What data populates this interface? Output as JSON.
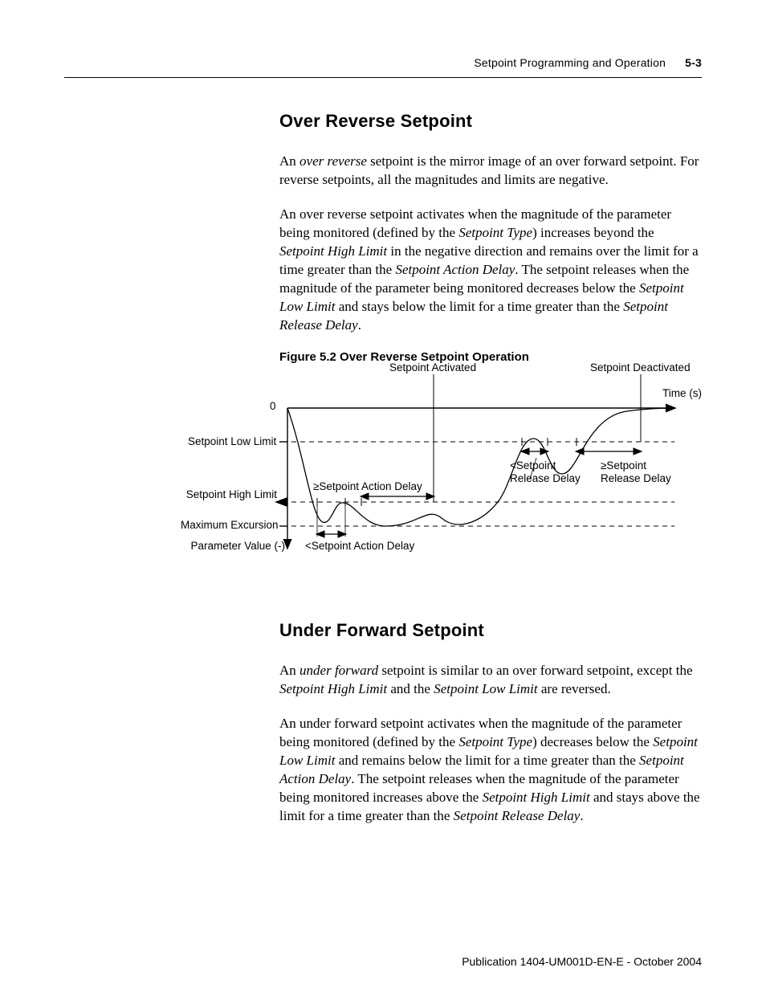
{
  "header": {
    "section": "Setpoint Programming and Operation",
    "page_number": "5-3"
  },
  "section1": {
    "heading": "Over Reverse Setpoint",
    "p1_a": "An ",
    "p1_b": "over reverse",
    "p1_c": " setpoint is the mirror image of an over forward setpoint. For reverse setpoints, all the magnitudes and limits are negative.",
    "p2_a": "An over reverse setpoint activates when the magnitude of the parameter being monitored (defined by the ",
    "p2_b": "Setpoint Type",
    "p2_c": ") increases beyond the ",
    "p2_d": "Setpoint High Limit",
    "p2_e": " in the negative direction and remains over the limit for a time greater than the ",
    "p2_f": "Setpoint Action Delay",
    "p2_g": ". The setpoint releases when the magnitude of the parameter being monitored decreases below the ",
    "p2_h": "Setpoint Low Limit",
    "p2_i": " and stays below the limit for a time greater than the ",
    "p2_j": "Setpoint Release Delay",
    "p2_k": "."
  },
  "figure": {
    "caption": "Figure 5.2 Over Reverse Setpoint Operation",
    "labels": {
      "setpoint_activated": "Setpoint Activated",
      "setpoint_deactivated": "Setpoint Deactivated",
      "time": "Time (s)",
      "zero": "0",
      "low_limit": "Setpoint Low Limit",
      "high_limit": "Setpoint High Limit",
      "max_excursion": "Maximum Excursion",
      "param_value": "Parameter Value (-)",
      "ge_action_delay": "≥Setpoint Action Delay",
      "lt_action_delay": "<Setpoint Action Delay",
      "lt_release_label": "<Setpoint\nRelease Delay",
      "ge_release_label": "≥Setpoint\nRelease Delay"
    }
  },
  "section2": {
    "heading": "Under Forward Setpoint",
    "p1_a": "An ",
    "p1_b": "under forward",
    "p1_c": " setpoint is similar to an over forward setpoint, except the ",
    "p1_d": "Setpoint High Limit",
    "p1_e": " and the ",
    "p1_f": "Setpoint Low Limit",
    "p1_g": " are reversed.",
    "p2_a": "An under forward setpoint activates when the magnitude of the parameter being monitored (defined by the ",
    "p2_b": "Setpoint Type",
    "p2_c": ") decreases below the ",
    "p2_d": "Setpoint Low Limit",
    "p2_e": " and remains below the limit for a time greater than the ",
    "p2_f": "Setpoint Action Delay",
    "p2_g": ". The setpoint releases when the magnitude of the parameter being monitored increases above the ",
    "p2_h": "Setpoint High Limit",
    "p2_i": " and stays above the limit for a time greater than the ",
    "p2_j": "Setpoint Release Delay",
    "p2_k": "."
  },
  "footer": {
    "text": "Publication 1404-UM001D-EN-E - October 2004"
  },
  "chart_data": {
    "type": "line",
    "title": "Figure 5.2 Over Reverse Setpoint Operation",
    "xlabel": "Time (s)",
    "ylabel": "Parameter Value (-)",
    "y_zero": 0,
    "y_low_limit": "Setpoint Low Limit (negative)",
    "y_high_limit": "Setpoint High Limit (more negative than Low Limit)",
    "y_max_excursion": "Maximum Excursion (most negative)",
    "events": [
      {
        "name": "Setpoint Activated",
        "approx_time_fraction": 0.36
      },
      {
        "name": "Setpoint Deactivated",
        "approx_time_fraction": 0.95
      }
    ],
    "intervals": [
      {
        "name": "<Setpoint Action Delay",
        "desc": "first High-Limit crossing to return below High Limit (brief dip)"
      },
      {
        "name": "≥Setpoint Action Delay",
        "desc": "second High-Limit crossing held long enough to activate"
      },
      {
        "name": "<Setpoint Release Delay",
        "desc": "rise above Low Limit not held long enough"
      },
      {
        "name": "≥Setpoint Release Delay",
        "desc": "rise above Low Limit held long enough to deactivate"
      }
    ],
    "curve_description": "Parameter starts at 0, dips past Low and briefly past High Limit, returns near High Limit, dips past High Limit again and stays (activation), oscillates near Max Excursion, rises past Low Limit briefly, dips again, then rises past Low Limit and stays (deactivation), approaching 0."
  }
}
